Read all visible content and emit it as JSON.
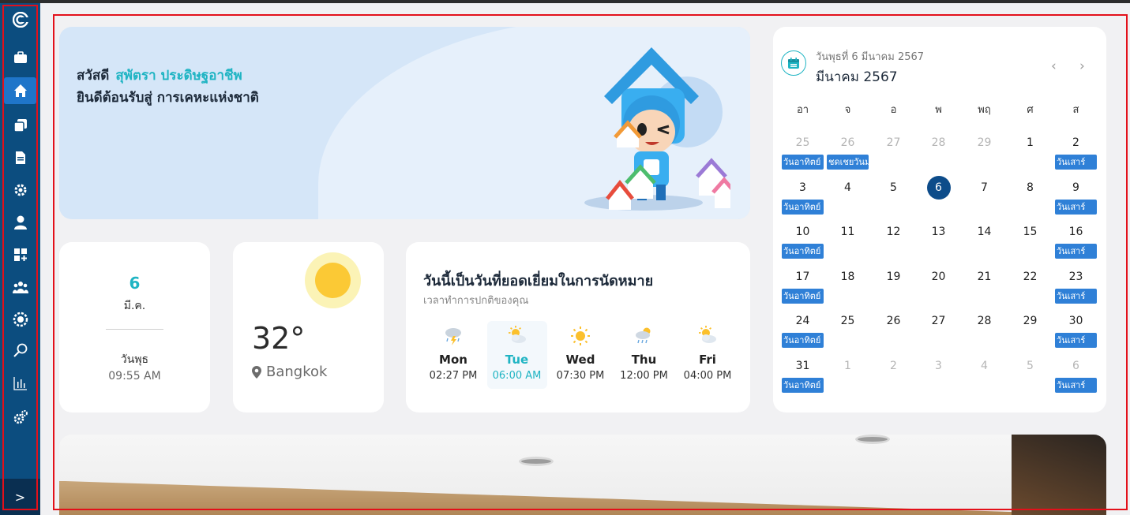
{
  "sidebar": {
    "icons": [
      "logo-icon",
      "briefcase-icon",
      "home-icon",
      "copy-icon",
      "document-icon",
      "gear-icon",
      "user-icon",
      "apps-add-icon",
      "group-icon",
      "coin-settings-icon",
      "search-icon",
      "chart-icon",
      "gears-icon"
    ],
    "active": "home-icon",
    "expand_label": ">"
  },
  "banner": {
    "hello": "สวัสดี",
    "name": "สุพัตรา ประดิษฐอาชีพ",
    "welcome": "ยินดีต้อนรับสู่ การเคหะแห่งชาติ"
  },
  "date_card": {
    "day": "6",
    "month": "มี.ค.",
    "weekday": "วันพุธ",
    "time": "09:55 AM"
  },
  "weather": {
    "temp": "32°",
    "location": "Bangkok"
  },
  "forecast": {
    "title": "วันนี้เป็นวันที่ยอดเยี่ยมในการนัดหมาย",
    "subtitle": "เวลาทำการปกติของคุณ",
    "days": [
      {
        "name": "Mon",
        "time": "02:27 PM",
        "icon": "thunderstorm-icon",
        "highlight": false
      },
      {
        "name": "Tue",
        "time": "06:00 AM",
        "icon": "partly-sunny-icon",
        "highlight": true
      },
      {
        "name": "Wed",
        "time": "07:30 PM",
        "icon": "sunny-icon",
        "highlight": false
      },
      {
        "name": "Thu",
        "time": "12:00 PM",
        "icon": "rain-sun-icon",
        "highlight": false
      },
      {
        "name": "Fri",
        "time": "04:00 PM",
        "icon": "partly-sunny-icon",
        "highlight": false
      }
    ]
  },
  "calendar": {
    "subtitle": "วันพุธที่ 6 มีนาคม 2567",
    "title": "มีนาคม 2567",
    "prev": "‹",
    "next": "›",
    "weekdays": [
      "อา",
      "จ",
      "อ",
      "พ",
      "พฤ",
      "ศ",
      "ส"
    ],
    "weeks": [
      [
        "25",
        "26",
        "27",
        "28",
        "29",
        "1",
        "2"
      ],
      [
        "3",
        "4",
        "5",
        "6",
        "7",
        "8",
        "9"
      ],
      [
        "10",
        "11",
        "12",
        "13",
        "14",
        "15",
        "16"
      ],
      [
        "17",
        "18",
        "19",
        "20",
        "21",
        "22",
        "23"
      ],
      [
        "24",
        "25",
        "26",
        "27",
        "28",
        "29",
        "30"
      ],
      [
        "31",
        "1",
        "2",
        "3",
        "4",
        "5",
        "6"
      ]
    ],
    "muted": [
      [
        0,
        0
      ],
      [
        0,
        1
      ],
      [
        0,
        2
      ],
      [
        0,
        3
      ],
      [
        0,
        4
      ],
      [
        5,
        1
      ],
      [
        5,
        2
      ],
      [
        5,
        3
      ],
      [
        5,
        4
      ],
      [
        5,
        5
      ],
      [
        5,
        6
      ]
    ],
    "today": [
      1,
      3
    ],
    "events": [
      {
        "week": 0,
        "col": 0,
        "label": "วันอาทิตย์"
      },
      {
        "week": 0,
        "col": 1,
        "label": "ชดเชยวันม"
      },
      {
        "week": 0,
        "col": 6,
        "label": "วันเสาร์"
      },
      {
        "week": 1,
        "col": 0,
        "label": "วันอาทิตย์"
      },
      {
        "week": 1,
        "col": 6,
        "label": "วันเสาร์"
      },
      {
        "week": 2,
        "col": 0,
        "label": "วันอาทิตย์"
      },
      {
        "week": 2,
        "col": 6,
        "label": "วันเสาร์"
      },
      {
        "week": 3,
        "col": 0,
        "label": "วันอาทิตย์"
      },
      {
        "week": 3,
        "col": 6,
        "label": "วันเสาร์"
      },
      {
        "week": 4,
        "col": 0,
        "label": "วันอาทิตย์"
      },
      {
        "week": 4,
        "col": 6,
        "label": "วันเสาร์"
      },
      {
        "week": 5,
        "col": 0,
        "label": "วันอาทิตย์"
      },
      {
        "week": 5,
        "col": 6,
        "label": "วันเสาร์"
      }
    ]
  },
  "colors": {
    "sidebar": "#0c4d7f",
    "accent": "#1fb4c3",
    "event": "#2f80d7",
    "today": "#0d4c8a"
  }
}
